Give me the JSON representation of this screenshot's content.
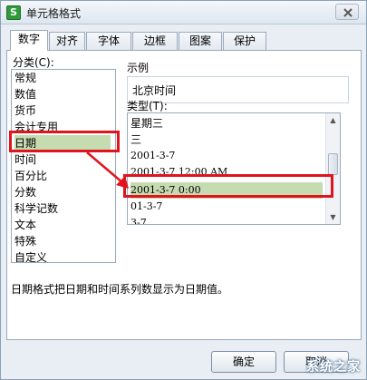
{
  "window": {
    "title": "单元格格式",
    "app_icon_letter": "S"
  },
  "tabs": [
    {
      "label": "数字",
      "active": true
    },
    {
      "label": "对齐",
      "active": false
    },
    {
      "label": "字体",
      "active": false
    },
    {
      "label": "边框",
      "active": false
    },
    {
      "label": "图案",
      "active": false
    },
    {
      "label": "保护",
      "active": false
    }
  ],
  "category": {
    "label": "分类(C):",
    "items": [
      "常规",
      "数值",
      "货币",
      "会计专用",
      "日期",
      "时间",
      "百分比",
      "分数",
      "科学记数",
      "文本",
      "特殊",
      "自定义"
    ],
    "selected": "日期"
  },
  "sample": {
    "label": "示例",
    "value": "北京时间"
  },
  "type": {
    "label": "类型(T):",
    "items": [
      "星期三",
      "三",
      "2001-3-7",
      "2001-3-7 12:00 AM",
      "2001-3-7 0:00",
      "01-3-7",
      "3-7"
    ],
    "selected": "2001-3-7 0:00"
  },
  "description": "日期格式把日期和时间系列数显示为日期值。",
  "buttons": {
    "ok": "确定",
    "cancel": "取消"
  },
  "watermark": "系统之家",
  "colors": {
    "highlight": "#c5dbb0",
    "annotation_red": "#e0141e"
  }
}
